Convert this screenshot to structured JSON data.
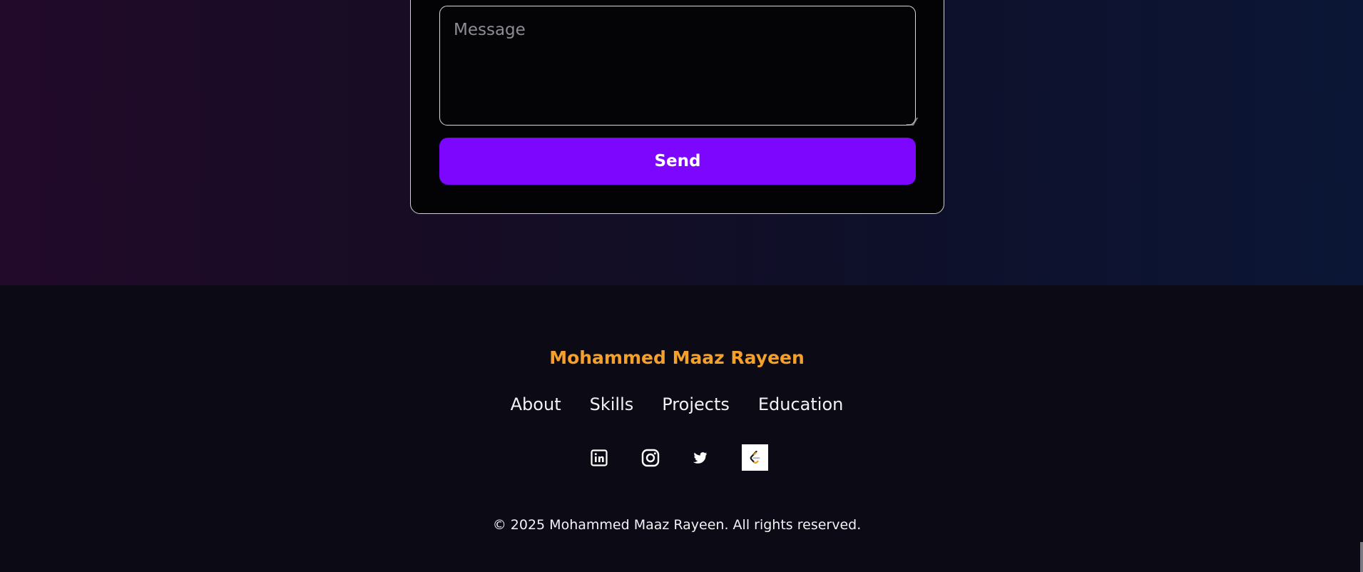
{
  "contact_form": {
    "message_placeholder": "Message",
    "send_label": "Send"
  },
  "footer": {
    "name": "Mohammed Maaz Rayeen",
    "nav": [
      {
        "label": "About"
      },
      {
        "label": "Skills"
      },
      {
        "label": "Projects"
      },
      {
        "label": "Education"
      }
    ],
    "social": [
      {
        "icon": "linkedin-icon"
      },
      {
        "icon": "instagram-icon"
      },
      {
        "icon": "twitter-icon"
      },
      {
        "icon": "leetcode-icon"
      }
    ],
    "copyright": "© 2025 Mohammed Maaz Rayeen. All rights reserved."
  },
  "colors": {
    "accent_purple": "#7d06fe",
    "brand_orange": "#f6a02c",
    "footer_bg": "#0b0a15"
  }
}
